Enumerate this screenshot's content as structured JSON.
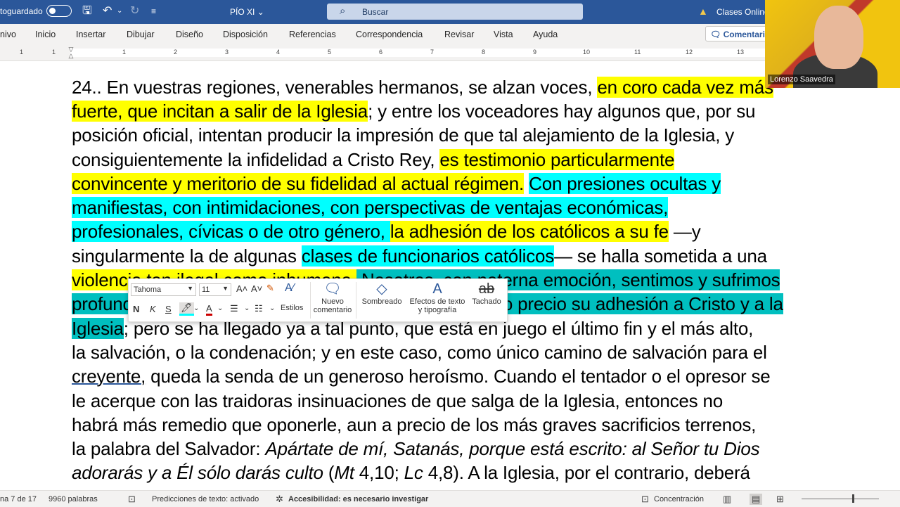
{
  "titlebar": {
    "autosave_label": "toguardado",
    "document_name": "PÍO XI",
    "document_caret": "⌄",
    "search_placeholder": "Buscar",
    "account_label": "Clases Online"
  },
  "menubar": {
    "tabs": [
      "nivo",
      "Inicio",
      "Insertar",
      "Dibujar",
      "Diseño",
      "Disposición",
      "Referencias",
      "Correspondencia",
      "Revisar",
      "Vista",
      "Ayuda"
    ],
    "comments_label": "Comentari"
  },
  "ruler": {
    "numbers": [
      "1",
      "1",
      "1",
      "2",
      "3",
      "4",
      "5",
      "6",
      "7",
      "8",
      "9",
      "10",
      "11",
      "12",
      "13"
    ]
  },
  "document": {
    "l1a": "24.. En vuestras regiones, venerables hermanos, se alzan voces, ",
    "l1b": "en coro cada vez más",
    "l2a": "fuerte, que incitan a salir de la Iglesia",
    "l2b": "; y entre los voceadores hay algunos que, por su",
    "l3": "posición oficial, intentan producir la impresión de que tal alejamiento de la Iglesia, y",
    "l4a": "consiguientemente la infidelidad a Cristo Rey, ",
    "l4b": "es testimonio particularmente",
    "l5a": "convincente y meritorio de su fidelidad al actual régimen.",
    "l5b": " ",
    "l5c": "Con presiones ocultas y",
    "l6": "manifiestas, con intimidaciones, con perspectivas de ventajas económicas,",
    "l7a": "profesionales, cívicas o de otro género, ",
    "l7b": "la adhesión de los católicos a su fe",
    "l7c": " —y",
    "l8a": "singularmente la de algunas ",
    "l8b": "clases de funcionarios católicos",
    "l8c": "— se halla sometida a una",
    "l9a": "violencia tan ilegal como inhumana.",
    "l9b": " Nosotros, con paterna emoción, sentimos y sufrimos",
    "l10a": "profundamente con aquellos que han pagado a tan alto precio su adhesión a Cristo y a la",
    "l11a": "Iglesia",
    "l11b": "; pero se ha llegado ya a tal punto, que está en juego el último fin y el más alto,",
    "l12": "la salvación, o la condenación; y en este caso, como único camino de salvación para el",
    "l13a": "creyente,",
    "l13b": " queda la senda de un generoso heroísmo. Cuando el tentador o el opresor se",
    "l14": "le acerque con las traidoras insinuaciones de que salga de la Iglesia, entonces no",
    "l15": "habrá más remedio que oponerle, aun a precio de los más graves sacrificios terrenos,",
    "l16a": "la palabra del Salvador: ",
    "l16b": "Apártate de mí, Satanás, porque está escrito: al Señor tu Dios",
    "l17a": "adorarás y a Él sólo darás culto",
    "l17b": " (",
    "l17c": "Mt",
    "l17d": " 4,10; ",
    "l17e": "Lc",
    "l17f": " 4,8). A la Iglesia, por el contrario, deberá"
  },
  "minitoolbar": {
    "font": "Tahoma",
    "size": "11",
    "bold": "N",
    "italic": "K",
    "underline": "S",
    "styles": "Estilos",
    "new_comment": "Nuevo comentario",
    "shading": "Sombreado",
    "text_effects": "Efectos de texto y tipografía",
    "strikethrough": "Tachado"
  },
  "webcam": {
    "name": "Lorenzo Saavedra"
  },
  "statusbar": {
    "page": "na 7 de 17",
    "words": "9960 palabras",
    "predictions": "Predicciones de texto: activado",
    "accessibility": "Accesibilidad: es necesario investigar",
    "focus": "Concentración"
  },
  "colors": {
    "titlebar": "#2b579a",
    "highlight_yellow": "#ffff00",
    "highlight_cyan": "#00ffff",
    "highlight_teal": "#00bfbf"
  }
}
